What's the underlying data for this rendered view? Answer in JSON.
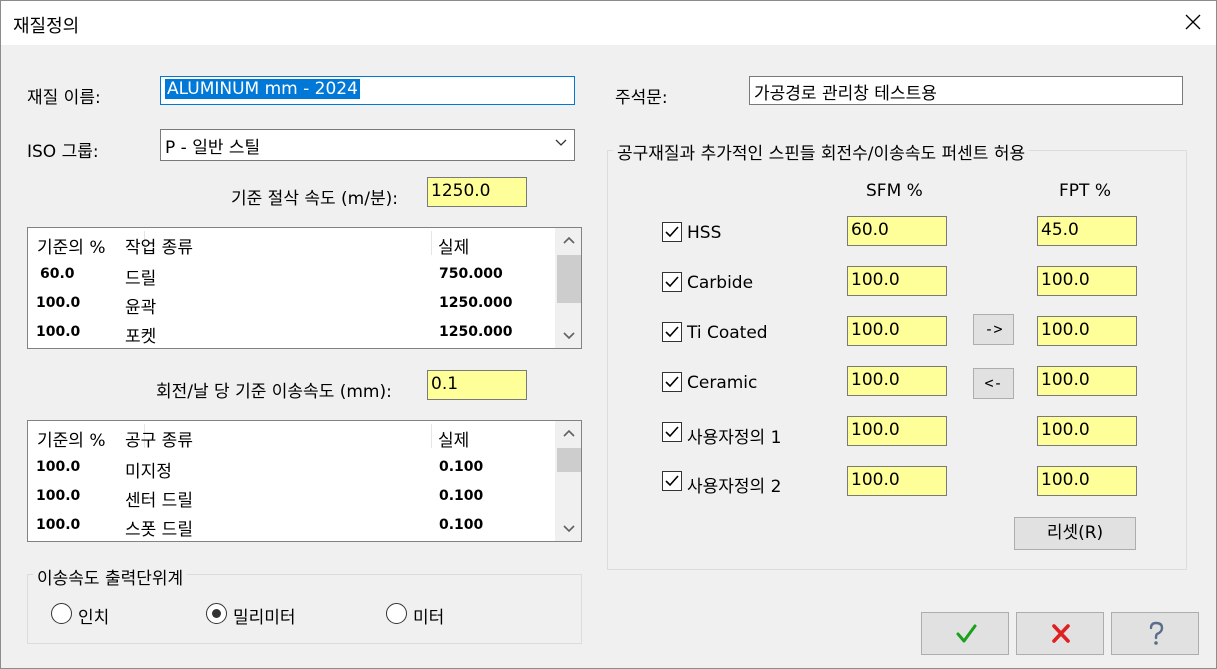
{
  "window": {
    "title": "재질정의"
  },
  "material_name": {
    "label": "재질 이름:",
    "value": "ALUMINUM mm - 2024"
  },
  "comment": {
    "label": "주석문:",
    "value": "가공경로 관리창 테스트용"
  },
  "iso_group": {
    "label": "ISO 그룹:",
    "selected": "P - 일반 스틸"
  },
  "base_cut_speed": {
    "label": "기준 절삭 속도 (m/분):",
    "value": "1250.0"
  },
  "ops_table": {
    "headers": [
      "기준의 %",
      "작업 종류",
      "실제"
    ],
    "rows": [
      [
        "60.0",
        "드릴",
        "750.000"
      ],
      [
        "100.0",
        "윤곽",
        "1250.000"
      ],
      [
        "100.0",
        "포켓",
        "1250.000"
      ]
    ]
  },
  "base_feed": {
    "label": "회전/날 당 기준 이송속도 (mm):",
    "value": "0.1"
  },
  "tools_table": {
    "headers": [
      "기준의 %",
      "공구 종류",
      "실제"
    ],
    "rows": [
      [
        "100.0",
        "미지정",
        "0.100"
      ],
      [
        "100.0",
        "센터 드릴",
        "0.100"
      ],
      [
        "100.0",
        "스폿 드릴",
        "0.100"
      ]
    ]
  },
  "feed_unit": {
    "title": "이송속도 출력단위계",
    "options": [
      "인치",
      "밀리미터",
      "미터"
    ],
    "selected": "밀리미터"
  },
  "tool_material": {
    "title": "공구재질과 추가적인 스핀들 회전수/이송속도 퍼센트 허용",
    "sfm_header": "SFM %",
    "fpt_header": "FPT %",
    "rows": [
      {
        "name": "HSS",
        "checked": true,
        "sfm": "60.0",
        "fpt": "45.0"
      },
      {
        "name": "Carbide",
        "checked": true,
        "sfm": "100.0",
        "fpt": "100.0"
      },
      {
        "name": "Ti Coated",
        "checked": true,
        "sfm": "100.0",
        "fpt": "100.0"
      },
      {
        "name": "Ceramic",
        "checked": true,
        "sfm": "100.0",
        "fpt": "100.0"
      },
      {
        "name": "사용자정의 1",
        "checked": true,
        "sfm": "100.0",
        "fpt": "100.0"
      },
      {
        "name": "사용자정의 2",
        "checked": true,
        "sfm": "100.0",
        "fpt": "100.0"
      }
    ],
    "copy_right_label": "->",
    "copy_left_label": "<-",
    "reset_label": "리셋(R)"
  },
  "footer": {
    "ok_icon": "checkmark-icon",
    "cancel_icon": "x-icon",
    "help_icon": "question-icon"
  },
  "colors": {
    "field_yellow": "#ffff99",
    "selection_blue": "#0078d7",
    "ok_green": "#1aa01a",
    "cancel_red": "#e02020"
  }
}
